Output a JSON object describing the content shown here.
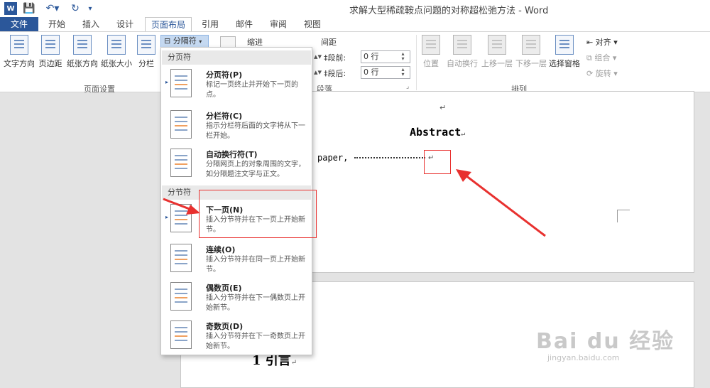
{
  "window": {
    "title": "求解大型稀疏鞍点问题的对称超松弛方法 - Word"
  },
  "tabs": {
    "file": "文件",
    "home": "开始",
    "insert": "插入",
    "design": "设计",
    "layout": "页面布局",
    "references": "引用",
    "mailings": "邮件",
    "review": "审阅",
    "view": "视图"
  },
  "ribbon": {
    "page_setup": {
      "group_label": "页面设置",
      "text_direction": "文字方向",
      "margins": "页边距",
      "orientation": "纸张方向",
      "size": "纸张大小",
      "columns": "分栏",
      "breaks": "分隔符"
    },
    "paragraph": {
      "group_label": "段落",
      "indent_label": "缩进",
      "spacing_label": "间距",
      "before_label": "段前:",
      "before_value": "0 行",
      "after_label": "段后:",
      "after_value": "0 行"
    },
    "arrange": {
      "group_label": "排列",
      "position": "位置",
      "wrap_text": "自动换行",
      "bring_forward": "上移一层",
      "send_backward": "下移一层",
      "selection_pane": "选择窗格",
      "align": "对齐",
      "group": "组合",
      "rotate": "旋转"
    }
  },
  "breaks_menu": {
    "page_breaks_header": "分页符",
    "section_breaks_header": "分节符",
    "items": [
      {
        "title": "分页符(P)",
        "desc": "标记一页终止并开始下一页的点。"
      },
      {
        "title": "分栏符(C)",
        "desc": "指示分栏符后面的文字将从下一栏开始。"
      },
      {
        "title": "自动换行符(T)",
        "desc": "分隔网页上的对象周围的文字，如分隔题注文字与正文。"
      },
      {
        "title": "下一页(N)",
        "desc": "插入分节符并在下一页上开始新节。"
      },
      {
        "title": "连续(O)",
        "desc": "插入分节符并在同一页上开始新节。"
      },
      {
        "title": "偶数页(E)",
        "desc": "插入分节符并在下一偶数页上开始新节。"
      },
      {
        "title": "奇数页(D)",
        "desc": "插入分节符并在下一奇数页上开始新节。"
      }
    ]
  },
  "document": {
    "para_mark_top": "↵",
    "heading": "Abstract",
    "heading_mark": "↵",
    "line_text": "paper,",
    "line_mark": "↵",
    "page2_heading": "1 引言",
    "page2_mark": "↵"
  },
  "watermark": {
    "brand": "Bai du 经验",
    "url": "jingyan.baidu.com"
  },
  "colors": {
    "accent": "#2b579a",
    "annotation": "#e8312f"
  }
}
